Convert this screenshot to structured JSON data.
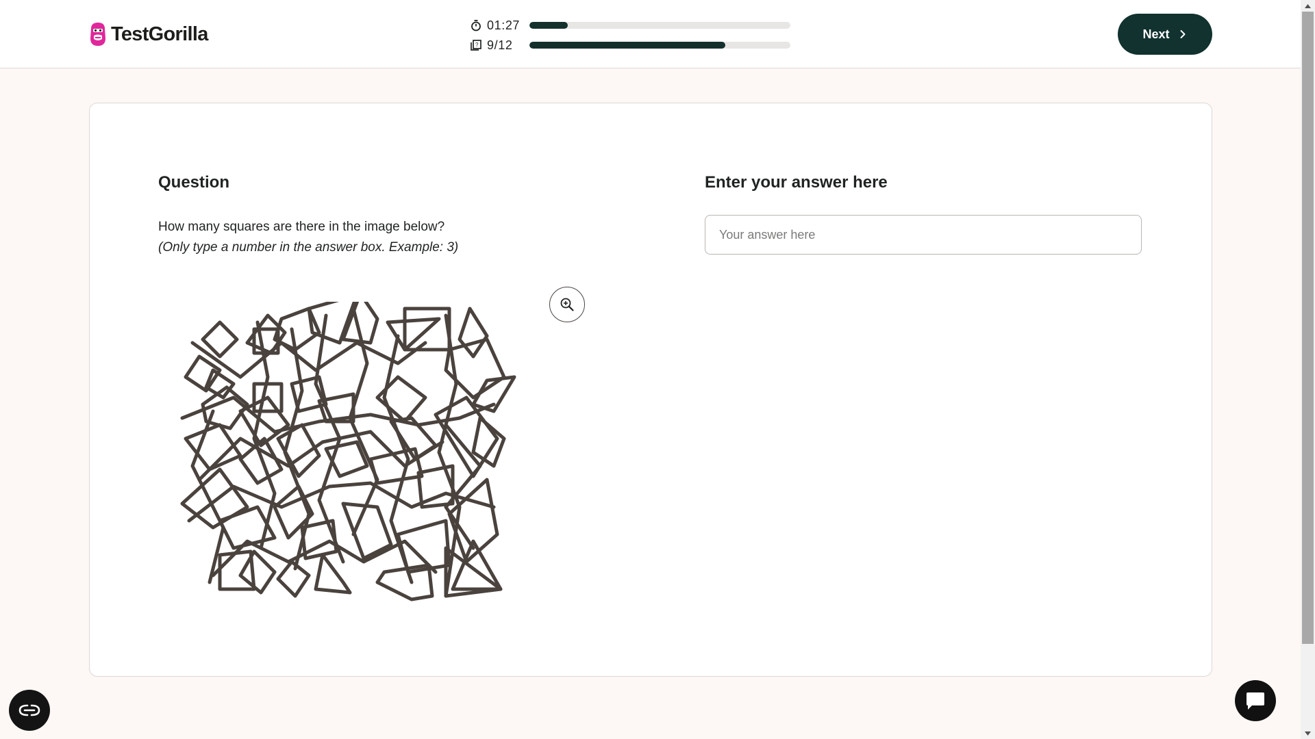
{
  "header": {
    "brand": "TestGorilla",
    "brand_color": "#e0279b",
    "timer": {
      "icon": "stopwatch-icon",
      "text": "01:27",
      "fraction": 0.147
    },
    "progress": {
      "icon": "questions-icon",
      "text": "9/12",
      "fraction": 0.75
    },
    "next_button": {
      "label": "Next",
      "icon": "chevron-right-icon"
    }
  },
  "question": {
    "heading": "Question",
    "text": "How many squares are there in the image below?",
    "hint": "(Only type a number in the answer box. Example: 3)",
    "zoom_icon": "zoom-in-icon"
  },
  "answer": {
    "heading": "Enter your answer here",
    "placeholder": "Your answer here",
    "value": ""
  },
  "floating": {
    "accessibility_icon": "accessibility-icon",
    "chat_icon": "chat-icon"
  },
  "colors": {
    "accent_dark": "#11322e",
    "page_bg": "#fdf8f5",
    "puzzle_stroke": "#4a423d"
  }
}
